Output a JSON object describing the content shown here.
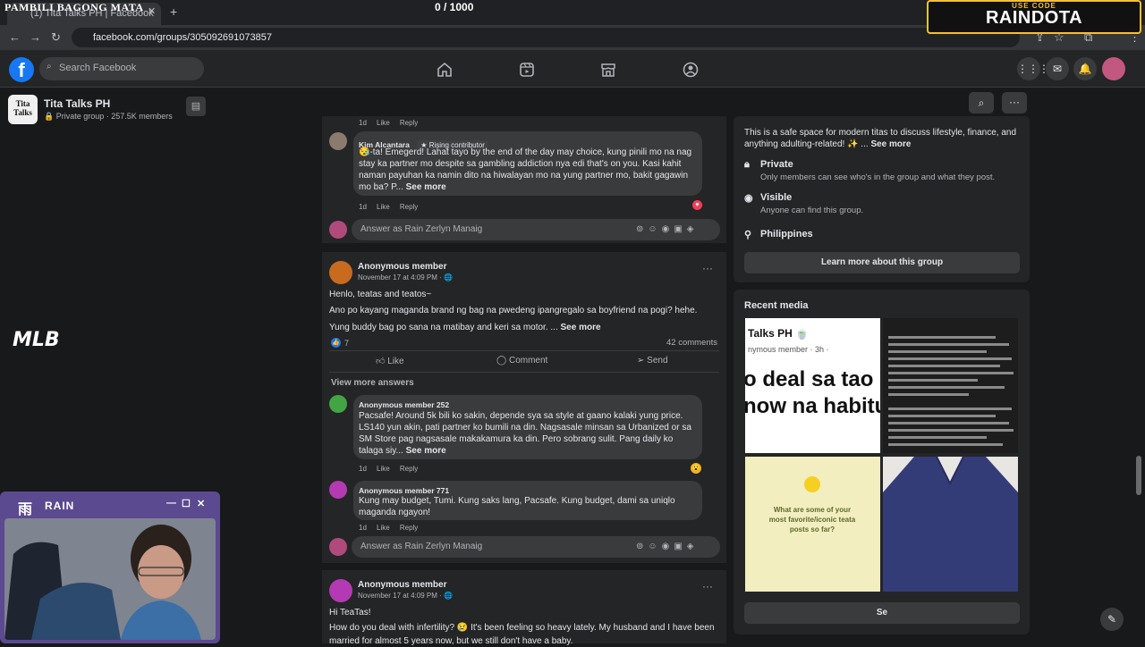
{
  "browser": {
    "tab_title": "(1) Tita Talks PH | Facebook",
    "url": "facebook.com/groups/305092691073857"
  },
  "facebook": {
    "search_placeholder": "Search Facebook",
    "brand_color": "#1877f2"
  },
  "group": {
    "name": "Tita Talks PH",
    "meta": "Private group · 257.5K members",
    "thumb_text": "Tita Talks"
  },
  "feed": {
    "top_comment_meta": {
      "time": "1d",
      "like": "Like",
      "reply": "Reply"
    },
    "kim_comment": {
      "author": "Kim Alcantara",
      "badge": "Rising contributor",
      "text": "😪-ta! Emegerd! Lahat tayo by the end of the day may choice, kung pinili mo na nag stay ka partner mo despite sa gambling addiction nya edi that's on you. Kasi kahit naman payuhan ka namin dito na hiwalayan mo na yung partner mo, bakit gagawin mo ba? P...",
      "see_more": "See more",
      "time": "1d",
      "like": "Like",
      "reply": "Reply"
    },
    "answer_placeholder": "Answer as Rain Zerlyn Manaig",
    "post1": {
      "author": "Anonymous member",
      "date": "November 17 at 4:09 PM · 🌐",
      "line1": "Henlo, teatas and teatos~",
      "line2": "Ano po kayang maganda brand ng bag na pwedeng ipangregalo sa boyfriend na pogi? hehe.",
      "line3": "Yung buddy bag po sana na matibay and keri sa motor. ...",
      "see_more": "See more",
      "reactions": "7",
      "comments": "42 comments",
      "like": "Like",
      "comment": "Comment",
      "send": "Send",
      "view_more": "View more answers",
      "c1_author": "Anonymous member 252",
      "c1_text": "Pacsafe! Around 5k bili ko sakin, depende sya sa style at gaano kalaki yung price. LS140 yun akin, pati partner ko bumili na din. Nagsasale minsan sa Urbanized or sa SM Store pag nagsasale makakamura ka din. Pero sobrang sulit. Pang daily ko talaga siy...",
      "c1_see_more": "See more",
      "c1_time": "1d",
      "c1_like": "Like",
      "c1_reply": "Reply",
      "c2_author": "Anonymous member 771",
      "c2_text": "Kung may budget, Tumi. Kung saks lang, Pacsafe. Kung budget, dami sa uniqlo maganda ngayon!",
      "c2_time": "1d",
      "c2_like": "Like",
      "c2_reply": "Reply"
    },
    "post2": {
      "author": "Anonymous member",
      "date": "November 17 at 4:09 PM · 🌐",
      "line1": "Hi TeaTas!",
      "line2": "How do you deal with infertility? 😢 It's been feeling so heavy lately. My husband and I have been",
      "line3": "married for almost 5 years now, but we still don't have a baby."
    }
  },
  "about": {
    "description": "This is a safe space for modern titas to discuss lifestyle, finance, and anything adulting-related! ✨ ...",
    "see_more": "See more",
    "private_title": "Private",
    "private_sub": "Only members can see who's in the group and what they post.",
    "visible_title": "Visible",
    "visible_sub": "Anyone can find this group.",
    "location": "Philippines",
    "learn_more": "Learn more about this group"
  },
  "recent_media": {
    "title": "Recent media",
    "thumb1_line1": "Talks PH 🍵",
    "thumb1_line2": "nymous member · 3h ·",
    "thumb1_big1": "o deal sa tao",
    "thumb1_big2": "now na habitu",
    "thumb3_text": "What are some of your most favorite/iconic teata posts so far?",
    "see_all": "Se"
  },
  "overlays": {
    "title": "PAMBILI BAGONG MATA",
    "counter": "0   / 1000",
    "promo_sub": "USE CODE",
    "promo_main": "RAINDOTA",
    "mlb": "MLB",
    "cam_brand": "RAIN",
    "cam_glyph": "雨"
  }
}
